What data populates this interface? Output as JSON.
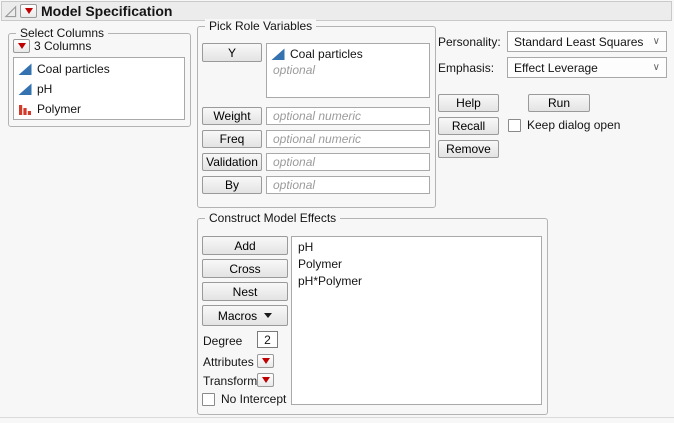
{
  "header": {
    "title": "Model Specification"
  },
  "select_columns": {
    "label": "Select Columns",
    "count_label": "3 Columns",
    "columns": [
      {
        "name": "Coal particles",
        "icon": "continuous-icon"
      },
      {
        "name": "pH",
        "icon": "continuous-icon"
      },
      {
        "name": "Polymer",
        "icon": "nominal-icon"
      }
    ]
  },
  "pick_roles": {
    "label": "Pick Role Variables",
    "y": {
      "button": "Y",
      "item": "Coal particles",
      "item_icon": "continuous-icon",
      "placeholder": "optional"
    },
    "weight": {
      "button": "Weight",
      "placeholder": "optional numeric"
    },
    "freq": {
      "button": "Freq",
      "placeholder": "optional numeric"
    },
    "validation": {
      "button": "Validation",
      "placeholder": "optional"
    },
    "by": {
      "button": "By",
      "placeholder": "optional"
    }
  },
  "personality": {
    "label": "Personality:",
    "value": "Standard Least Squares"
  },
  "emphasis": {
    "label": "Emphasis:",
    "value": "Effect Leverage"
  },
  "actions": {
    "help": "Help",
    "run": "Run",
    "recall": "Recall",
    "remove": "Remove",
    "keep_dialog_open": "Keep dialog open",
    "keep_dialog_open_checked": false
  },
  "construct": {
    "label": "Construct Model Effects",
    "add": "Add",
    "cross": "Cross",
    "nest": "Nest",
    "macros": "Macros",
    "degree_label": "Degree",
    "degree_value": "2",
    "attributes_label": "Attributes",
    "transform_label": "Transform",
    "no_intercept_label": "No Intercept",
    "no_intercept_checked": false,
    "effects": [
      "pH",
      "Polymer",
      "pH*Polymer"
    ]
  },
  "colors": {
    "menu_triangle_red": "#c00000",
    "continuous_blue": "#3572b0",
    "nominal_red": "#d33a2a",
    "header_band": "#ececec"
  }
}
